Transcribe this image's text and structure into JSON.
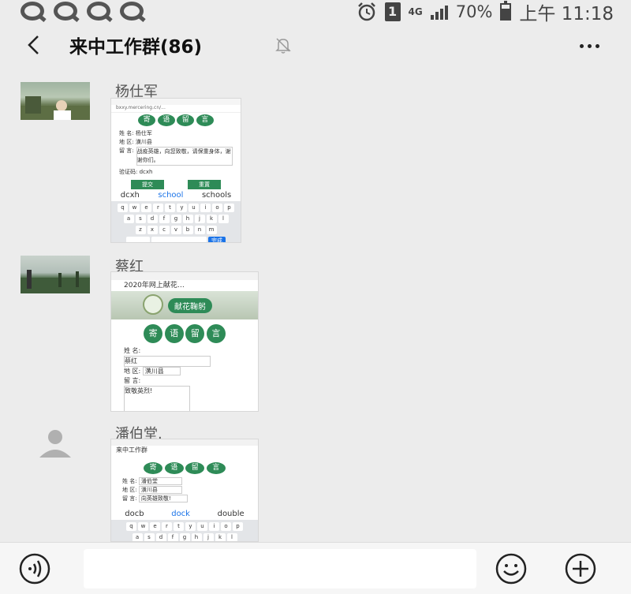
{
  "status_bar": {
    "network": "4G",
    "sim_slot": "1",
    "battery": "70%",
    "time": "上午 11:18"
  },
  "header": {
    "back_icon": "chevron-left-icon",
    "title": "来中工作群(86)",
    "mute_icon": "bell-off-icon",
    "more_icon": "more-dots-icon"
  },
  "messages": [
    {
      "sender": "杨仕军",
      "thumb": {
        "url": "bxxy.mercering.cn/...",
        "buttons": [
          "寄",
          "语",
          "留",
          "言"
        ],
        "fields": [
          {
            "label": "姓 名:",
            "value": "杨仕军"
          },
          {
            "label": "地 区:",
            "value": "潢川县"
          },
          {
            "label": "留 言:",
            "value": "战疫英雄，向您致敬，请保重身体，谢谢你们。"
          }
        ],
        "code_label": "验证码:",
        "code_value": "dcxh",
        "submit": "提交",
        "reset": "重置",
        "suggestions": [
          "dcxh",
          "school",
          "schools"
        ],
        "rows": [
          [
            "q",
            "w",
            "e",
            "r",
            "t",
            "y",
            "u",
            "i",
            "o",
            "p"
          ],
          [
            "a",
            "s",
            "d",
            "f",
            "g",
            "h",
            "j",
            "k",
            "l"
          ],
          [
            "z",
            "x",
            "c",
            "v",
            "b",
            "n",
            "m"
          ]
        ],
        "done": "完成"
      }
    },
    {
      "sender": "蔡红",
      "thumb": {
        "page_title": "2020年网上献花…",
        "banner": "献花鞠躬",
        "buttons": [
          "寄",
          "语",
          "留",
          "言"
        ],
        "fields": [
          {
            "label": "姓 名:",
            "value": "蔡红"
          },
          {
            "label": "地 区:",
            "value": "潢川县"
          },
          {
            "label": "留 言:",
            "value": "致敬英烈!"
          }
        ]
      }
    },
    {
      "sender": "潘伯堂.",
      "thumb": {
        "chat_header": "来中工作群",
        "buttons": [
          "寄",
          "语",
          "留",
          "言"
        ],
        "fields": [
          {
            "label": "姓 名:",
            "value": "潘伯堂"
          },
          {
            "label": "地 区:",
            "value": "潢川县"
          },
          {
            "label": "留 言:",
            "value": "向英雄致敬!"
          }
        ],
        "suggestions": [
          "docb",
          "dock",
          "double"
        ]
      }
    }
  ],
  "input_bar": {
    "voice_icon": "voice-icon",
    "emoji_icon": "emoji-icon",
    "plus_icon": "plus-icon",
    "text_value": ""
  }
}
